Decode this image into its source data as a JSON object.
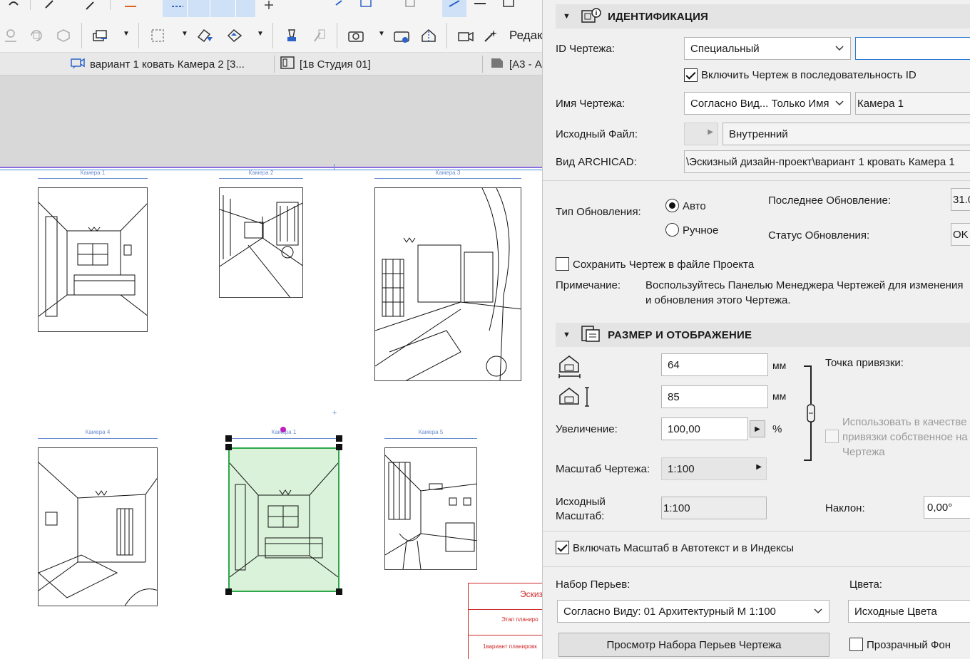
{
  "toolbar": {
    "edit_label": "Редак"
  },
  "tabs": [
    {
      "label": "вариант 1 ковать Камера 2 [3..."
    },
    {
      "label": "[1в Студия 01]"
    },
    {
      "label": "[А3 - А"
    }
  ],
  "canvas": {
    "drawings": [
      {
        "label": "Камера 1"
      },
      {
        "label": "Камера 2"
      },
      {
        "label": "Камера 3"
      },
      {
        "label": "Камера 4"
      },
      {
        "label": "Камера 1"
      },
      {
        "label": "Камера 5"
      }
    ],
    "title_block": {
      "line1": "Эскиз",
      "line2": "Этап планиро",
      "line3": "1вариант планировк"
    }
  },
  "identification": {
    "title": "ИДЕНТИФИКАЦИЯ",
    "drawing_id_label": "ID Чертежа:",
    "drawing_id_value": "Специальный",
    "drawing_id_text": "",
    "include_sequence_label": "Включить Чертеж в последовательность ID",
    "drawing_name_label": "Имя Чертежа:",
    "drawing_name_mode": "Согласно Вид... Только Имя",
    "drawing_name_value": "Камера 1",
    "source_file_label": "Исходный Файл:",
    "source_file_value": "Внутренний",
    "archicad_view_label": "Вид ARCHICAD:",
    "archicad_view_value": "\\Эскизный дизайн-проект\\вариант 1 кровать Камера 1",
    "update_type_label": "Тип Обновления:",
    "update_auto": "Авто",
    "update_manual": "Ручное",
    "last_update_label": "Последнее Обновление:",
    "last_update_value": "31.0",
    "update_status_label": "Статус Обновления:",
    "update_status_value": "OK",
    "save_in_project_label": "Сохранить Чертеж в файле Проекта",
    "note_label": "Примечание:",
    "note_line1": "Воспользуйтесь Панелью Менеджера Чертежей для изменения",
    "note_line2": "и обновления этого Чертежа."
  },
  "size_display": {
    "title": "РАЗМЕР И ОТОБРАЖЕНИЕ",
    "width_value": "64",
    "height_value": "85",
    "unit": "мм",
    "anchor_label": "Точка привязки:",
    "magnification_label": "Увеличение:",
    "magnification_value": "100,00",
    "percent": "%",
    "use_as_anchor_line1": "Использовать в качестве",
    "use_as_anchor_line2": "привязки собственное на",
    "use_as_anchor_line3": "Чертежа",
    "drawing_scale_label": "Масштаб Чертежа:",
    "drawing_scale_value": "1:100",
    "original_scale_label1": "Исходный",
    "original_scale_label2": "Масштаб:",
    "original_scale_value": "1:100",
    "angle_label": "Наклон:",
    "angle_value": "0,00°",
    "include_scale_label": "Включать Масштаб в Автотекст и в Индексы",
    "pen_set_label": "Набор Перьев:",
    "pen_set_value": "Согласно Виду: 01 Архитектурный М 1:100",
    "colors_label": "Цвета:",
    "colors_value": "Исходные Цвета",
    "preview_pen_button": "Просмотр Набора Перьев Чертежа",
    "transparent_bg_label": "Прозрачный Фон"
  }
}
